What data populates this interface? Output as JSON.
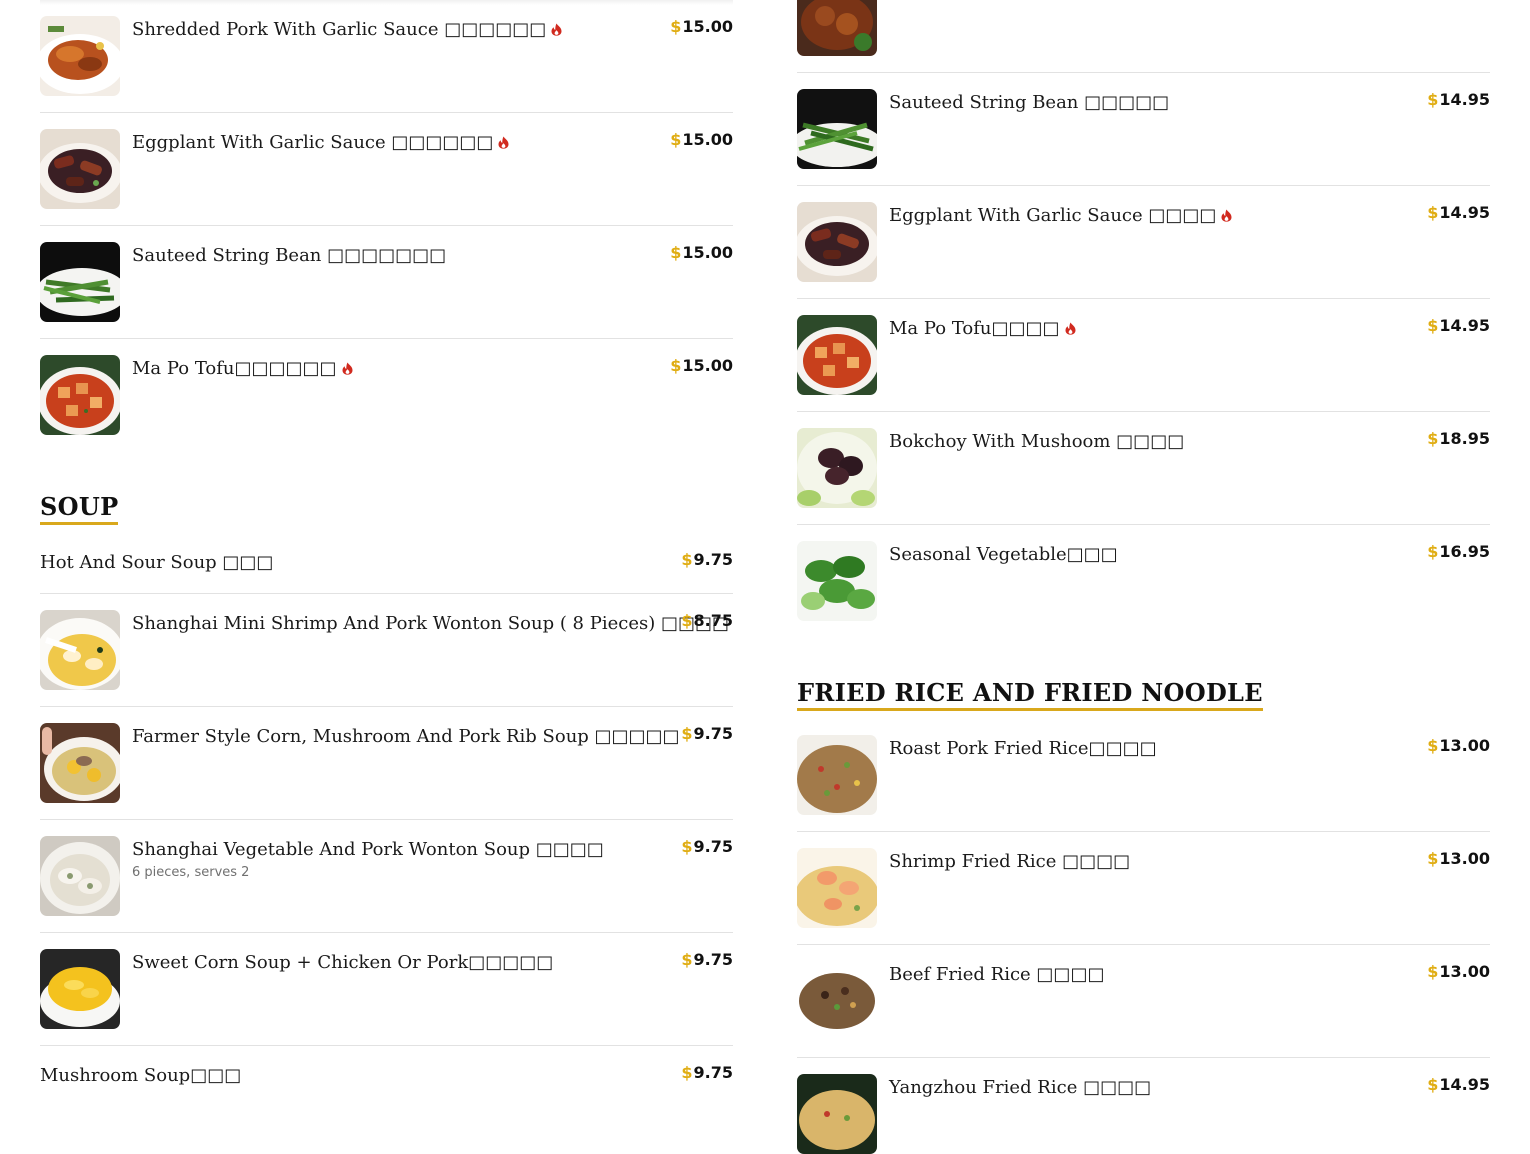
{
  "currency_symbol": "$",
  "colors": {
    "accent": "#e0ad13",
    "spicy": "#d12a1f",
    "divider": "#e2e2e2"
  },
  "left_column": {
    "items": [
      {
        "name": "Shredded Pork With Garlic Sauce □□□□□□",
        "price": "15.00",
        "spicy": true,
        "image": "shredded-pork-photo"
      },
      {
        "name": "Eggplant With Garlic Sauce □□□□□□",
        "price": "15.00",
        "spicy": true,
        "image": "eggplant-photo"
      },
      {
        "name": "Sauteed String Bean □□□□□□□",
        "price": "15.00",
        "spicy": false,
        "image": "string-bean-photo"
      },
      {
        "name": "Ma Po Tofu□□□□□□",
        "price": "15.00",
        "spicy": true,
        "image": "mapo-tofu-photo"
      }
    ],
    "soup_section": {
      "title": "SOUP",
      "items": [
        {
          "name": "Hot And Sour Soup □□□",
          "price": "9.75",
          "image": null
        },
        {
          "name": "Shanghai Mini Shrimp And Pork Wonton Soup ( 8 Pieces) □□□□",
          "price": "8.75",
          "image": "mini-wonton-soup-photo"
        },
        {
          "name": "Farmer Style Corn, Mushroom And Pork Rib Soup □□□□□",
          "price": "9.75",
          "image": "corn-rib-soup-photo"
        },
        {
          "name": "Shanghai Vegetable And Pork Wonton Soup □□□□",
          "price": "9.75",
          "description": "6 pieces, serves 2",
          "image": "vegetable-wonton-soup-photo"
        },
        {
          "name": "Sweet Corn Soup + Chicken Or Pork□□□□□",
          "price": "9.75",
          "image": "sweet-corn-soup-photo"
        },
        {
          "name": "Mushroom Soup□□□",
          "price": "9.75",
          "image": null
        }
      ]
    }
  },
  "right_column": {
    "items": [
      {
        "name": "",
        "price": "",
        "image": "braised-dish-photo-partial"
      },
      {
        "name": "Sauteed String Bean □□□□□",
        "price": "14.95",
        "spicy": false,
        "image": "string-bean-photo"
      },
      {
        "name": "Eggplant With Garlic Sauce □□□□",
        "price": "14.95",
        "spicy": true,
        "image": "eggplant-photo"
      },
      {
        "name": "Ma Po Tofu□□□□",
        "price": "14.95",
        "spicy": true,
        "image": "mapo-tofu-photo"
      },
      {
        "name": "Bokchoy With Mushoom □□□□",
        "price": "18.95",
        "spicy": false,
        "image": "bokchoy-mushroom-photo"
      },
      {
        "name": "Seasonal Vegetable□□□",
        "price": "16.95",
        "spicy": false,
        "image": "seasonal-vegetable-photo"
      }
    ],
    "fried_section": {
      "title": "FRIED RICE AND FRIED NOODLE",
      "items": [
        {
          "name": "Roast Pork Fried Rice□□□□",
          "price": "13.00",
          "image": "pork-fried-rice-photo"
        },
        {
          "name": "Shrimp Fried Rice □□□□",
          "price": "13.00",
          "image": "shrimp-fried-rice-photo"
        },
        {
          "name": "Beef Fried Rice □□□□",
          "price": "13.00",
          "image": "beef-fried-rice-photo"
        },
        {
          "name": "Yangzhou Fried Rice □□□□",
          "price": "14.95",
          "image": "yangzhou-fried-rice-photo"
        }
      ]
    }
  }
}
